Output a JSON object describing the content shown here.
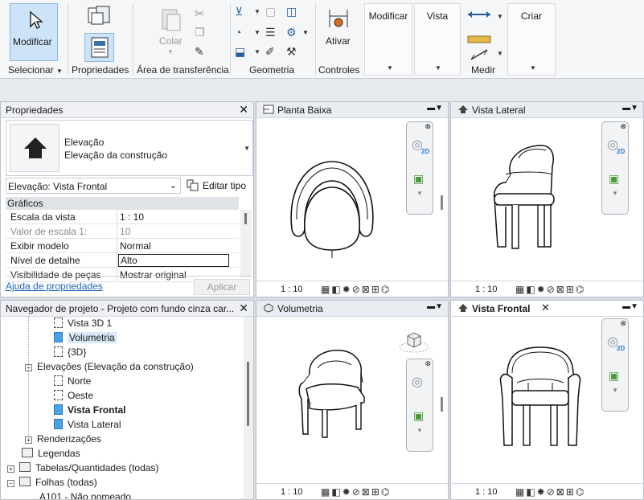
{
  "ribbon": {
    "selecionar": {
      "button": "Modificar",
      "label": "Selecionar"
    },
    "propriedades": {
      "label": "Propriedades"
    },
    "clipboard": {
      "colar": "Colar",
      "label": "Área de transferência"
    },
    "geometria": {
      "label": "Geometria"
    },
    "controles": {
      "ativar": "Ativar",
      "label": "Controles"
    },
    "modificar": "Modificar",
    "vista": "Vista",
    "medir": {
      "label": "Medir"
    },
    "criar": "Criar"
  },
  "properties": {
    "title": "Propriedades",
    "type_line1": "Elevação",
    "type_line2": "Elevação da construção",
    "selector": "Elevação: Vista Frontal",
    "edit_type": "Editar tipo",
    "section": "Gráficos",
    "rows": [
      {
        "k": "Escala da vista",
        "v": "1 : 10"
      },
      {
        "k": "Valor de escala    1:",
        "v": "10"
      },
      {
        "k": "Exibir modelo",
        "v": "Normal"
      },
      {
        "k": "Nível de detalhe",
        "v": "Alto"
      },
      {
        "k": "Visibilidade de peças",
        "v": "Mostrar original"
      }
    ],
    "help_link": "Ajuda de propriedades",
    "apply": "Aplicar"
  },
  "browser": {
    "title": "Navegador de projeto - Projeto com fundo cinza car...",
    "items": [
      "Vista 3D 1",
      "Volumetria",
      "{3D}",
      "Elevações (Elevação da construção)",
      "Norte",
      "Oeste",
      "Vista Frontal",
      "Vista Lateral",
      "Renderizações",
      "Legendas",
      "Tabelas/Quantidades (todas)",
      "Folhas (todas)",
      "A101 - Não nomeado"
    ]
  },
  "views": {
    "planta": {
      "title": "Planta Baixa",
      "scale": "1 : 10"
    },
    "lateral": {
      "title": "Vista Lateral",
      "scale": "1 : 10"
    },
    "volumetria": {
      "title": "Volumetria",
      "scale": "1 : 10"
    },
    "frontal": {
      "title": "Vista Frontal",
      "scale": "1 : 10"
    }
  },
  "colors": {
    "accent": "#cde3f9",
    "selected": "#4aa3e6"
  }
}
